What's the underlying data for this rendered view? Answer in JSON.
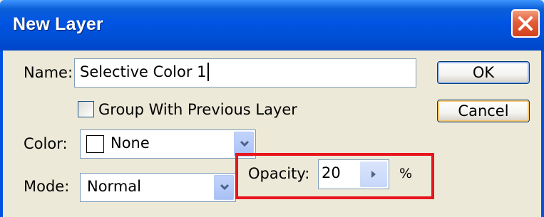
{
  "window": {
    "title": "New Layer"
  },
  "form": {
    "name_label": "Name:",
    "name_value": "Selective Color 1",
    "group_label": "Group With Previous Layer",
    "group_checked": false,
    "color_label": "Color:",
    "color_value": "None",
    "mode_label": "Mode:",
    "mode_value": "Normal",
    "opacity_label": "Opacity:",
    "opacity_value": "20",
    "opacity_unit": "%"
  },
  "buttons": {
    "ok_label": "OK",
    "cancel_label": "Cancel"
  },
  "colors": {
    "titlebar": "#0054e3",
    "highlight": "#e8141e",
    "close_button": "#d3411c"
  },
  "icons": {
    "close": "close-icon",
    "dropdown": "chevron-down-icon",
    "stepper": "arrow-right-icon"
  }
}
